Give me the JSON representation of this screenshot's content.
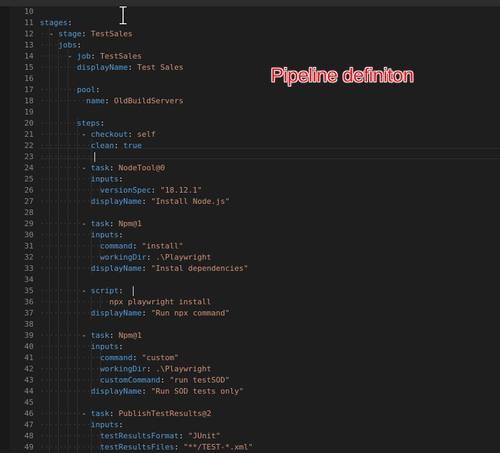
{
  "editor": {
    "language": "yaml",
    "colors": {
      "background": "#1e1e1e",
      "key": "#569cd6",
      "string": "#ce9178",
      "boolean": "#569cd6",
      "line_number": "#858585"
    },
    "active_line": 23,
    "lines": [
      {
        "n": "10",
        "t": []
      },
      {
        "n": "11",
        "t": [
          [
            "k",
            "stages"
          ],
          [
            "p",
            ":"
          ]
        ]
      },
      {
        "n": "12",
        "t": [
          [
            "ws",
            "··"
          ],
          [
            "p",
            "- "
          ],
          [
            "k",
            "stage"
          ],
          [
            "p",
            ": "
          ],
          [
            "s",
            "TestSales"
          ]
        ]
      },
      {
        "n": "13",
        "t": [
          [
            "ws",
            "····"
          ],
          [
            "k",
            "jobs"
          ],
          [
            "p",
            ":"
          ]
        ]
      },
      {
        "n": "14",
        "t": [
          [
            "ws",
            "······"
          ],
          [
            "p",
            "- "
          ],
          [
            "k",
            "job"
          ],
          [
            "p",
            ": "
          ],
          [
            "s",
            "TestSales"
          ]
        ]
      },
      {
        "n": "15",
        "t": [
          [
            "ws",
            "········"
          ],
          [
            "k",
            "displayName"
          ],
          [
            "p",
            ": "
          ],
          [
            "s",
            "Test Sales"
          ]
        ]
      },
      {
        "n": "16",
        "t": []
      },
      {
        "n": "17",
        "t": [
          [
            "ws",
            "········"
          ],
          [
            "k",
            "pool"
          ],
          [
            "p",
            ":"
          ]
        ]
      },
      {
        "n": "18",
        "t": [
          [
            "ws",
            "··········"
          ],
          [
            "k",
            "name"
          ],
          [
            "p",
            ": "
          ],
          [
            "s",
            "OldBuildServers"
          ]
        ]
      },
      {
        "n": "19",
        "t": []
      },
      {
        "n": "20",
        "t": [
          [
            "ws",
            "········"
          ],
          [
            "k",
            "steps"
          ],
          [
            "p",
            ":"
          ]
        ]
      },
      {
        "n": "21",
        "t": [
          [
            "ws",
            "·········"
          ],
          [
            "p",
            "- "
          ],
          [
            "k",
            "checkout"
          ],
          [
            "p",
            ": "
          ],
          [
            "s",
            "self"
          ]
        ]
      },
      {
        "n": "22",
        "t": [
          [
            "ws",
            "···········"
          ],
          [
            "k",
            "clean"
          ],
          [
            "p",
            ": "
          ],
          [
            "b",
            "true"
          ]
        ]
      },
      {
        "n": "23",
        "t": [
          [
            "ws",
            "···········"
          ]
        ]
      },
      {
        "n": "24",
        "t": [
          [
            "ws",
            "·········"
          ],
          [
            "p",
            "- "
          ],
          [
            "k",
            "task"
          ],
          [
            "p",
            ": "
          ],
          [
            "s",
            "NodeTool@0"
          ]
        ]
      },
      {
        "n": "25",
        "t": [
          [
            "ws",
            "···········"
          ],
          [
            "k",
            "inputs"
          ],
          [
            "p",
            ":"
          ]
        ]
      },
      {
        "n": "26",
        "t": [
          [
            "ws",
            "·············"
          ],
          [
            "k",
            "versionSpec"
          ],
          [
            "p",
            ": "
          ],
          [
            "s",
            "\"18.12.1\""
          ]
        ]
      },
      {
        "n": "27",
        "t": [
          [
            "ws",
            "···········"
          ],
          [
            "k",
            "displayName"
          ],
          [
            "p",
            ": "
          ],
          [
            "s",
            "\"Install Node.js\""
          ]
        ]
      },
      {
        "n": "28",
        "t": []
      },
      {
        "n": "29",
        "t": [
          [
            "ws",
            "·········"
          ],
          [
            "p",
            "- "
          ],
          [
            "k",
            "task"
          ],
          [
            "p",
            ": "
          ],
          [
            "s",
            "Npm@1"
          ]
        ]
      },
      {
        "n": "30",
        "t": [
          [
            "ws",
            "···········"
          ],
          [
            "k",
            "inputs"
          ],
          [
            "p",
            ":"
          ]
        ]
      },
      {
        "n": "31",
        "t": [
          [
            "ws",
            "·············"
          ],
          [
            "k",
            "command"
          ],
          [
            "p",
            ": "
          ],
          [
            "s",
            "\"install\""
          ]
        ]
      },
      {
        "n": "32",
        "t": [
          [
            "ws",
            "·············"
          ],
          [
            "k",
            "workingDir"
          ],
          [
            "p",
            ": "
          ],
          [
            "s",
            ".\\Playwright"
          ]
        ]
      },
      {
        "n": "33",
        "t": [
          [
            "ws",
            "···········"
          ],
          [
            "k",
            "displayName"
          ],
          [
            "p",
            ": "
          ],
          [
            "s",
            "\"Instal dependencies\""
          ]
        ]
      },
      {
        "n": "34",
        "t": []
      },
      {
        "n": "35",
        "t": [
          [
            "ws",
            "·········"
          ],
          [
            "p",
            "- "
          ],
          [
            "k",
            "script"
          ],
          [
            "p",
            ": "
          ]
        ]
      },
      {
        "n": "36",
        "t": [
          [
            "ws",
            "···············"
          ],
          [
            "s",
            "npx playwright install"
          ]
        ]
      },
      {
        "n": "37",
        "t": [
          [
            "ws",
            "···········"
          ],
          [
            "k",
            "displayName"
          ],
          [
            "p",
            ": "
          ],
          [
            "s",
            "\"Run npx command\""
          ]
        ]
      },
      {
        "n": "38",
        "t": []
      },
      {
        "n": "39",
        "t": [
          [
            "ws",
            "·········"
          ],
          [
            "p",
            "- "
          ],
          [
            "k",
            "task"
          ],
          [
            "p",
            ": "
          ],
          [
            "s",
            "Npm@1"
          ]
        ]
      },
      {
        "n": "40",
        "t": [
          [
            "ws",
            "···········"
          ],
          [
            "k",
            "inputs"
          ],
          [
            "p",
            ":"
          ]
        ]
      },
      {
        "n": "41",
        "t": [
          [
            "ws",
            "·············"
          ],
          [
            "k",
            "command"
          ],
          [
            "p",
            ": "
          ],
          [
            "s",
            "\"custom\""
          ]
        ]
      },
      {
        "n": "42",
        "t": [
          [
            "ws",
            "·············"
          ],
          [
            "k",
            "workingDir"
          ],
          [
            "p",
            ": "
          ],
          [
            "s",
            ".\\Playwright"
          ]
        ]
      },
      {
        "n": "43",
        "t": [
          [
            "ws",
            "·············"
          ],
          [
            "k",
            "customCommand"
          ],
          [
            "p",
            ": "
          ],
          [
            "s",
            "\"run testSOD\""
          ]
        ]
      },
      {
        "n": "44",
        "t": [
          [
            "ws",
            "···········"
          ],
          [
            "k",
            "displayName"
          ],
          [
            "p",
            ": "
          ],
          [
            "s",
            "\"Run SOD tests only\""
          ]
        ]
      },
      {
        "n": "45",
        "t": []
      },
      {
        "n": "46",
        "t": [
          [
            "ws",
            "·········"
          ],
          [
            "p",
            "- "
          ],
          [
            "k",
            "task"
          ],
          [
            "p",
            ": "
          ],
          [
            "s",
            "PublishTestResults@2"
          ]
        ]
      },
      {
        "n": "47",
        "t": [
          [
            "ws",
            "···········"
          ],
          [
            "k",
            "inputs"
          ],
          [
            "p",
            ":"
          ]
        ]
      },
      {
        "n": "48",
        "t": [
          [
            "ws",
            "·············"
          ],
          [
            "k",
            "testResultsFormat"
          ],
          [
            "p",
            ": "
          ],
          [
            "s",
            "\"JUnit\""
          ]
        ]
      },
      {
        "n": "49",
        "t": [
          [
            "ws",
            "·············"
          ],
          [
            "k",
            "testResultsFiles"
          ],
          [
            "p",
            ": "
          ],
          [
            "s",
            "\"**/TEST-*.xml\""
          ]
        ]
      }
    ]
  },
  "annotation": {
    "text": "Pipeline definiton",
    "color": "#e8141e"
  },
  "pointer": {
    "icon": "text-ibeam-cursor-icon"
  }
}
